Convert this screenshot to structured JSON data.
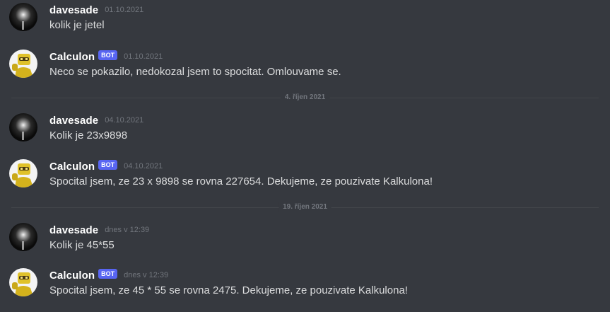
{
  "colors": {
    "background": "#36393f",
    "username": "#ffffff",
    "message_text": "#dcddde",
    "timestamp": "#72767d",
    "bot_tag": "#5865f2",
    "divider_line": "#42454a"
  },
  "messages": [
    {
      "author": "davesade",
      "avatar": "dark-avatar",
      "timestamp": "01.10.2021",
      "text": "kolik je jetel"
    },
    {
      "author": "Calculon",
      "avatar": "calculon-robot-avatar",
      "bot_tag": "BOT",
      "timestamp": "01.10.2021",
      "text": "Neco se pokazilo, nedokozal jsem to spocitat. Omlouvame se."
    },
    {
      "author": "davesade",
      "avatar": "dark-avatar",
      "timestamp": "04.10.2021",
      "text": "Kolik je 23x9898"
    },
    {
      "author": "Calculon",
      "avatar": "calculon-robot-avatar",
      "bot_tag": "BOT",
      "timestamp": "04.10.2021",
      "text": "Spocital jsem, ze 23 x 9898 se rovna 227654. Dekujeme, ze pouzivate Kalkulona!"
    },
    {
      "author": "davesade",
      "avatar": "dark-avatar",
      "timestamp": "dnes v 12:39",
      "text": "Kolik je 45*55"
    },
    {
      "author": "Calculon",
      "avatar": "calculon-robot-avatar",
      "bot_tag": "BOT",
      "timestamp": "dnes v 12:39",
      "text": "Spocital jsem, ze 45 * 55 se rovna 2475. Dekujeme, ze pouzivate Kalkulona!"
    }
  ],
  "dividers": [
    {
      "label": "4. říjen 2021"
    },
    {
      "label": "19. říjen 2021"
    }
  ]
}
